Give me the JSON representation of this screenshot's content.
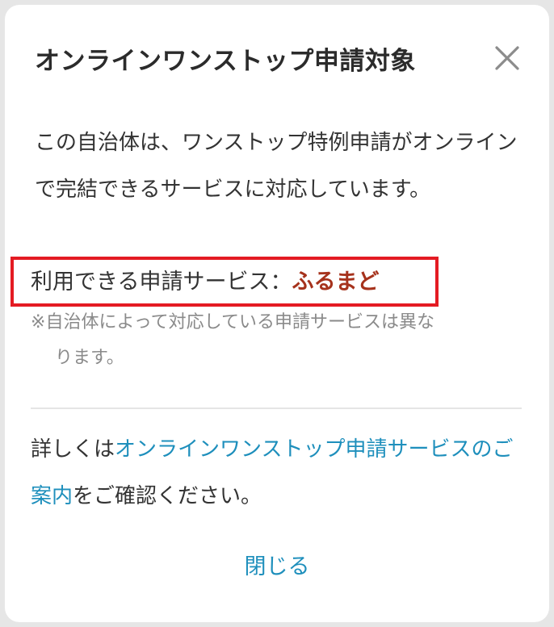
{
  "dialog": {
    "title": "オンラインワンストップ申請対象",
    "description": "この自治体は、ワンストップ特例申請がオンラインで完結できるサービスに対応しています。",
    "service_label": "利用できる申請サービス：",
    "service_name": "ふるまど",
    "note_mark": "※",
    "note_text": "自治体によって対応している申請サービスは異な",
    "note_text_cont": "ります。",
    "detail_prefix": "詳しくは",
    "detail_link": "オンラインワンストップ申請サービスのご案内",
    "detail_suffix": "をご確認ください。",
    "close_label": "閉じる"
  },
  "colors": {
    "highlight_border": "#e41b23",
    "service_name": "#a6321c",
    "link": "#1e8fbc"
  },
  "icons": {
    "close": "close-icon"
  }
}
